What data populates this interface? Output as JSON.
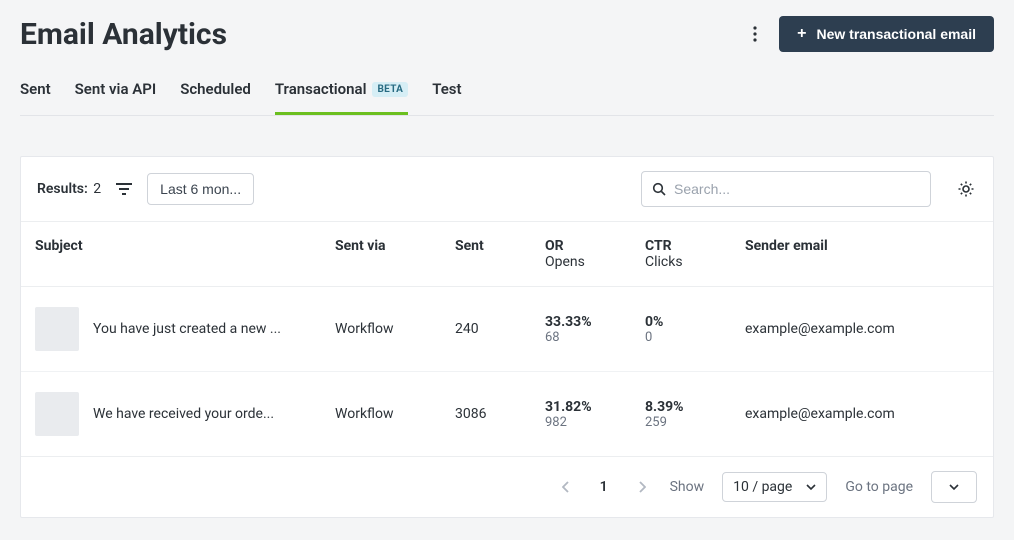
{
  "header": {
    "title": "Email Analytics",
    "new_button_label": "New transactional email"
  },
  "tabs": [
    {
      "label": "Sent",
      "badge": null,
      "active": false
    },
    {
      "label": "Sent via API",
      "badge": null,
      "active": false
    },
    {
      "label": "Scheduled",
      "badge": null,
      "active": false
    },
    {
      "label": "Transactional",
      "badge": "BETA",
      "active": true
    },
    {
      "label": "Test",
      "badge": null,
      "active": false
    }
  ],
  "toolbar": {
    "results_label": "Results:",
    "results_count": "2",
    "date_filter_label": "Last 6 mon...",
    "search_placeholder": "Search..."
  },
  "columns": {
    "subject": "Subject",
    "sent_via": "Sent via",
    "sent": "Sent",
    "or_main": "OR",
    "or_sub": "Opens",
    "ctr_main": "CTR",
    "ctr_sub": "Clicks",
    "sender": "Sender email"
  },
  "rows": [
    {
      "subject": "You have just created a new ...",
      "sent_via": "Workflow",
      "sent": "240",
      "or_pct": "33.33%",
      "or_count": "68",
      "ctr_pct": "0%",
      "ctr_count": "0",
      "sender": "example@example.com"
    },
    {
      "subject": "We have received your orde...",
      "sent_via": "Workflow",
      "sent": "3086",
      "or_pct": "31.82%",
      "or_count": "982",
      "ctr_pct": "8.39%",
      "ctr_count": "259",
      "sender": "example@example.com"
    }
  ],
  "pagination": {
    "current_page": "1",
    "show_label": "Show",
    "per_page": "10 / page",
    "goto_label": "Go to page"
  }
}
